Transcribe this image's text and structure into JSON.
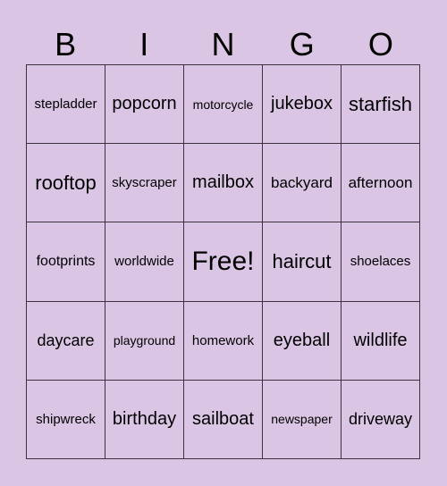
{
  "header": [
    "B",
    "I",
    "N",
    "G",
    "O"
  ],
  "cells": [
    [
      "stepladder",
      "popcorn",
      "motorcycle",
      "jukebox",
      "starfish"
    ],
    [
      "rooftop",
      "skyscraper",
      "mailbox",
      "backyard",
      "afternoon"
    ],
    [
      "footprints",
      "worldwide",
      "Free!",
      "haircut",
      "shoelaces"
    ],
    [
      "daycare",
      "playground",
      "homework",
      "eyeball",
      "wildlife"
    ],
    [
      "shipwreck",
      "birthday",
      "sailboat",
      "newspaper",
      "driveway"
    ]
  ]
}
